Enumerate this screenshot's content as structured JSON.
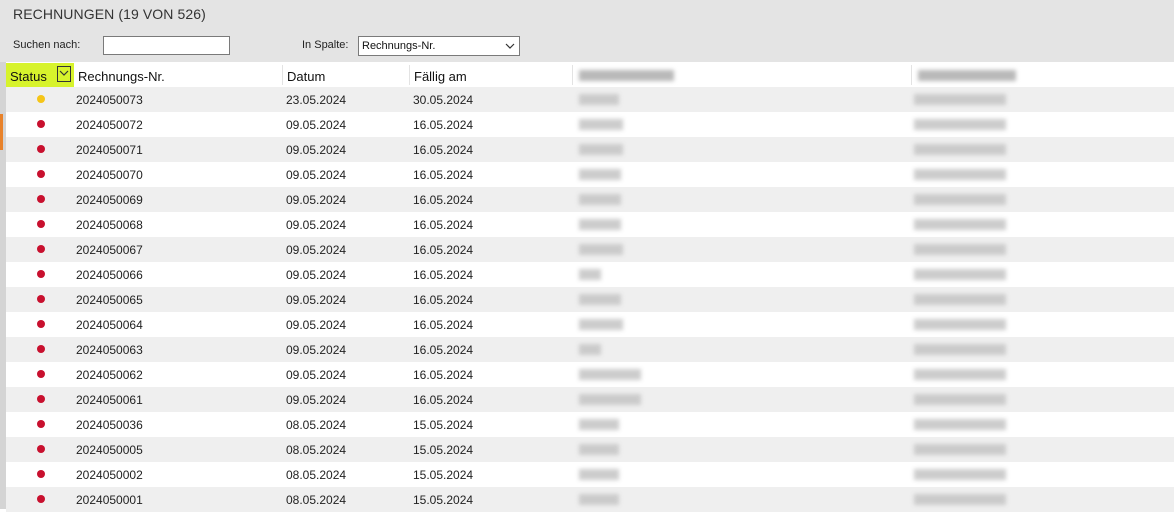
{
  "window": {
    "title": "RECHNUNGEN (19 VON 526)"
  },
  "search": {
    "label": "Suchen nach:",
    "value": "",
    "column_label": "In Spalte:",
    "column_value": "Rechnungs-Nr."
  },
  "table": {
    "columns": [
      "Status",
      "Rechnungs-Nr.",
      "Datum",
      "Fällig am"
    ],
    "status_colors": {
      "pending": "#f5c518",
      "overdue": "#c8102e"
    },
    "rows": [
      {
        "status": "pending",
        "nr": "2024050073",
        "datum": "23.05.2024",
        "faellig": "30.05.2024"
      },
      {
        "status": "overdue",
        "nr": "2024050072",
        "datum": "09.05.2024",
        "faellig": "16.05.2024"
      },
      {
        "status": "overdue",
        "nr": "2024050071",
        "datum": "09.05.2024",
        "faellig": "16.05.2024"
      },
      {
        "status": "overdue",
        "nr": "2024050070",
        "datum": "09.05.2024",
        "faellig": "16.05.2024"
      },
      {
        "status": "overdue",
        "nr": "2024050069",
        "datum": "09.05.2024",
        "faellig": "16.05.2024"
      },
      {
        "status": "overdue",
        "nr": "2024050068",
        "datum": "09.05.2024",
        "faellig": "16.05.2024"
      },
      {
        "status": "overdue",
        "nr": "2024050067",
        "datum": "09.05.2024",
        "faellig": "16.05.2024"
      },
      {
        "status": "overdue",
        "nr": "2024050066",
        "datum": "09.05.2024",
        "faellig": "16.05.2024"
      },
      {
        "status": "overdue",
        "nr": "2024050065",
        "datum": "09.05.2024",
        "faellig": "16.05.2024"
      },
      {
        "status": "overdue",
        "nr": "2024050064",
        "datum": "09.05.2024",
        "faellig": "16.05.2024"
      },
      {
        "status": "overdue",
        "nr": "2024050063",
        "datum": "09.05.2024",
        "faellig": "16.05.2024"
      },
      {
        "status": "overdue",
        "nr": "2024050062",
        "datum": "09.05.2024",
        "faellig": "16.05.2024"
      },
      {
        "status": "overdue",
        "nr": "2024050061",
        "datum": "09.05.2024",
        "faellig": "16.05.2024"
      },
      {
        "status": "overdue",
        "nr": "2024050036",
        "datum": "08.05.2024",
        "faellig": "15.05.2024"
      },
      {
        "status": "overdue",
        "nr": "2024050005",
        "datum": "08.05.2024",
        "faellig": "15.05.2024"
      },
      {
        "status": "overdue",
        "nr": "2024050002",
        "datum": "08.05.2024",
        "faellig": "15.05.2024"
      },
      {
        "status": "overdue",
        "nr": "2024050001",
        "datum": "08.05.2024",
        "faellig": "15.05.2024"
      }
    ]
  }
}
